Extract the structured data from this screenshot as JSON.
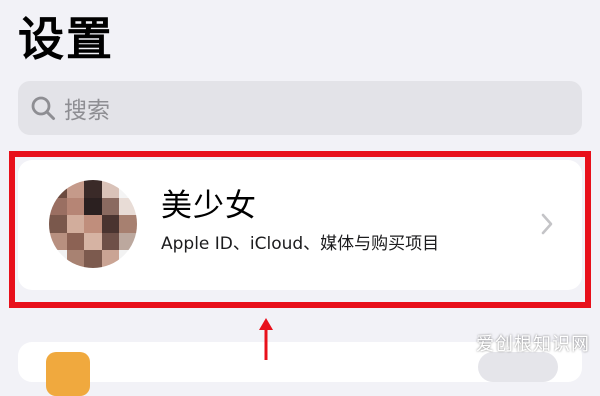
{
  "page": {
    "title": "设置"
  },
  "search": {
    "placeholder": "搜索",
    "icon": "search-icon"
  },
  "account": {
    "name": "美少女",
    "subtitle": "Apple ID、iCloud、媒体与购买项目",
    "avatar": "pixelated-avatar",
    "chevron": "chevron-right-icon"
  },
  "annotation": {
    "highlight_color": "#e8101b",
    "arrow": "up-arrow"
  },
  "watermark": {
    "text": "爱创根知识网"
  },
  "colors": {
    "background": "#f2f2f7",
    "card": "#ffffff",
    "search_bg": "#e3e3e8",
    "secondary_text": "#8e8e93"
  }
}
